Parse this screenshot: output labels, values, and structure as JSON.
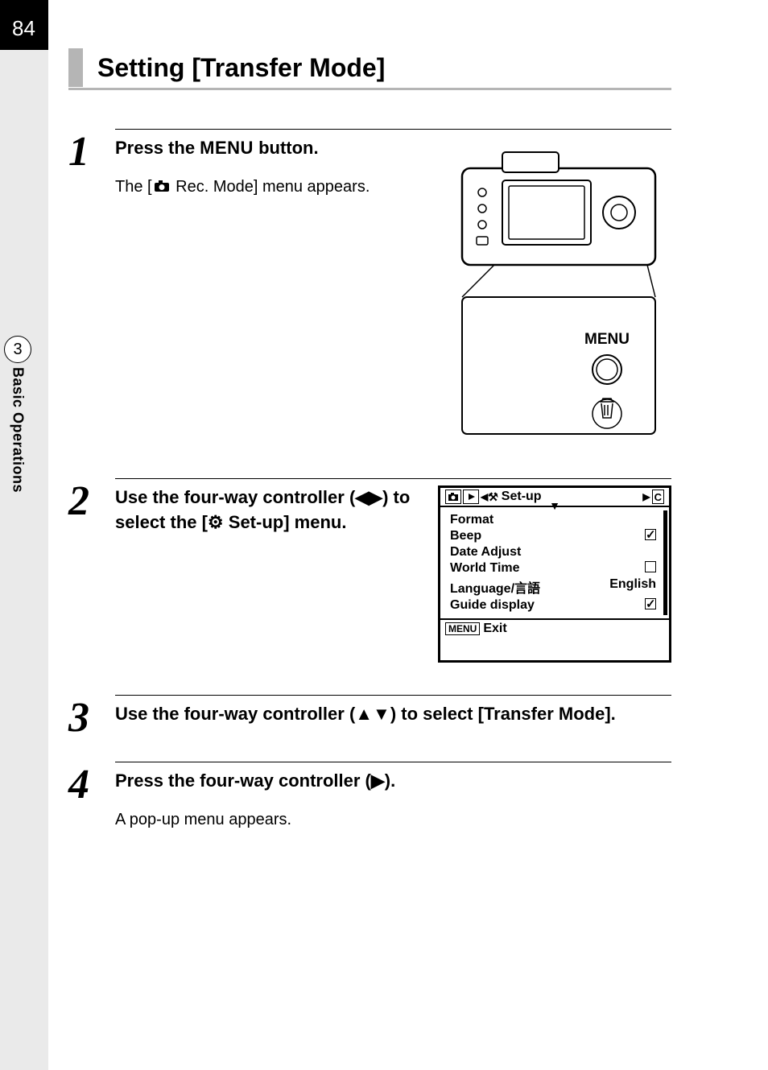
{
  "page_number": "84",
  "chapter": {
    "number": "3",
    "label": "Basic Operations"
  },
  "heading": "Setting [Transfer Mode]",
  "steps": {
    "s1": {
      "num": "1",
      "title_pre": "Press the ",
      "title_menu": "MENU",
      "title_post": " button.",
      "body_pre": "The [",
      "body_post": " Rec. Mode] menu appears."
    },
    "s2": {
      "num": "2",
      "title": "Use the four-way controller (◀▶) to select the [⚙ Set-up] menu."
    },
    "s3": {
      "num": "3",
      "title": "Use the four-way controller (▲▼) to select [Transfer Mode]."
    },
    "s4": {
      "num": "4",
      "title": "Press the four-way controller (▶).",
      "body": "A pop-up menu appears."
    }
  },
  "lcd": {
    "title": "Set-up",
    "tab_c": "C",
    "rows": {
      "format": {
        "label": "Format",
        "value": ""
      },
      "beep": {
        "label": "Beep",
        "value": "checked"
      },
      "date": {
        "label": "Date Adjust",
        "value": ""
      },
      "world": {
        "label": "World Time",
        "value": "unchecked"
      },
      "lang": {
        "label": "Language/言語",
        "value": "English"
      },
      "guide": {
        "label": "Guide display",
        "value": "checked"
      }
    },
    "footer_menu": "MENU",
    "footer_exit": "Exit"
  },
  "camera_menu_label": "MENU"
}
